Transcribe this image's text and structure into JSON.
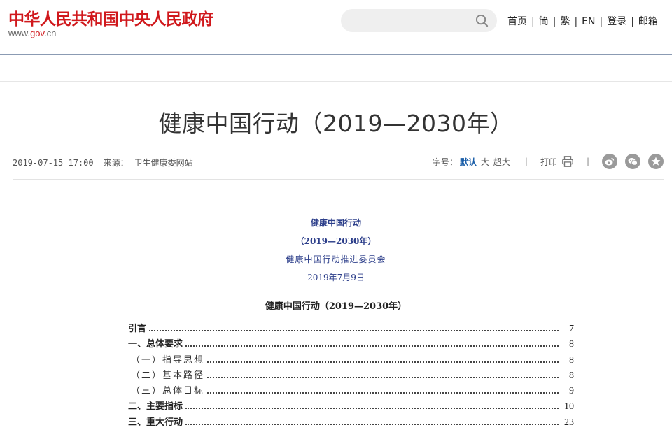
{
  "header": {
    "logo_title": "中华人民共和国中央人民政府",
    "logo_url_prefix": "www.",
    "logo_url_mid": "gov",
    "logo_url_suffix": ".cn",
    "search": {
      "placeholder": ""
    },
    "nav": [
      "首页",
      "简",
      "繁",
      "EN",
      "登录",
      "邮箱"
    ]
  },
  "article": {
    "title": "健康中国行动（2019—2030年）",
    "date": "2019-07-15 17:00",
    "source_label": "来源：",
    "source": "卫生健康委网站",
    "font_size_label": "字号：",
    "font_default": "默认",
    "font_large": "大",
    "font_xlarge": "超大",
    "print_label": "打印",
    "share_icons": [
      "weibo-icon",
      "wechat-icon",
      "favorite-icon"
    ]
  },
  "document": {
    "heading_lines": [
      "健康中国行动",
      "（2019—2030年）",
      "健康中国行动推进委员会",
      "2019年7月9日"
    ],
    "toc_title": "健康中国行动（2019—2030年）",
    "toc": [
      {
        "label": "引言",
        "page": "7",
        "level": 1
      },
      {
        "label": "一、总体要求",
        "page": "8",
        "level": 1
      },
      {
        "label": "（一）指导思想",
        "page": "8",
        "level": 2
      },
      {
        "label": "（二）基本路径",
        "page": "8",
        "level": 2
      },
      {
        "label": "（三）总体目标",
        "page": "9",
        "level": 2
      },
      {
        "label": "二、主要指标",
        "page": "10",
        "level": 1
      },
      {
        "label": "三、重大行动",
        "page": "23",
        "level": 1
      }
    ]
  },
  "colors": {
    "brand_red": "#d0181c",
    "link_blue": "#1a5ea8",
    "doc_blue": "#2c3e8a"
  }
}
